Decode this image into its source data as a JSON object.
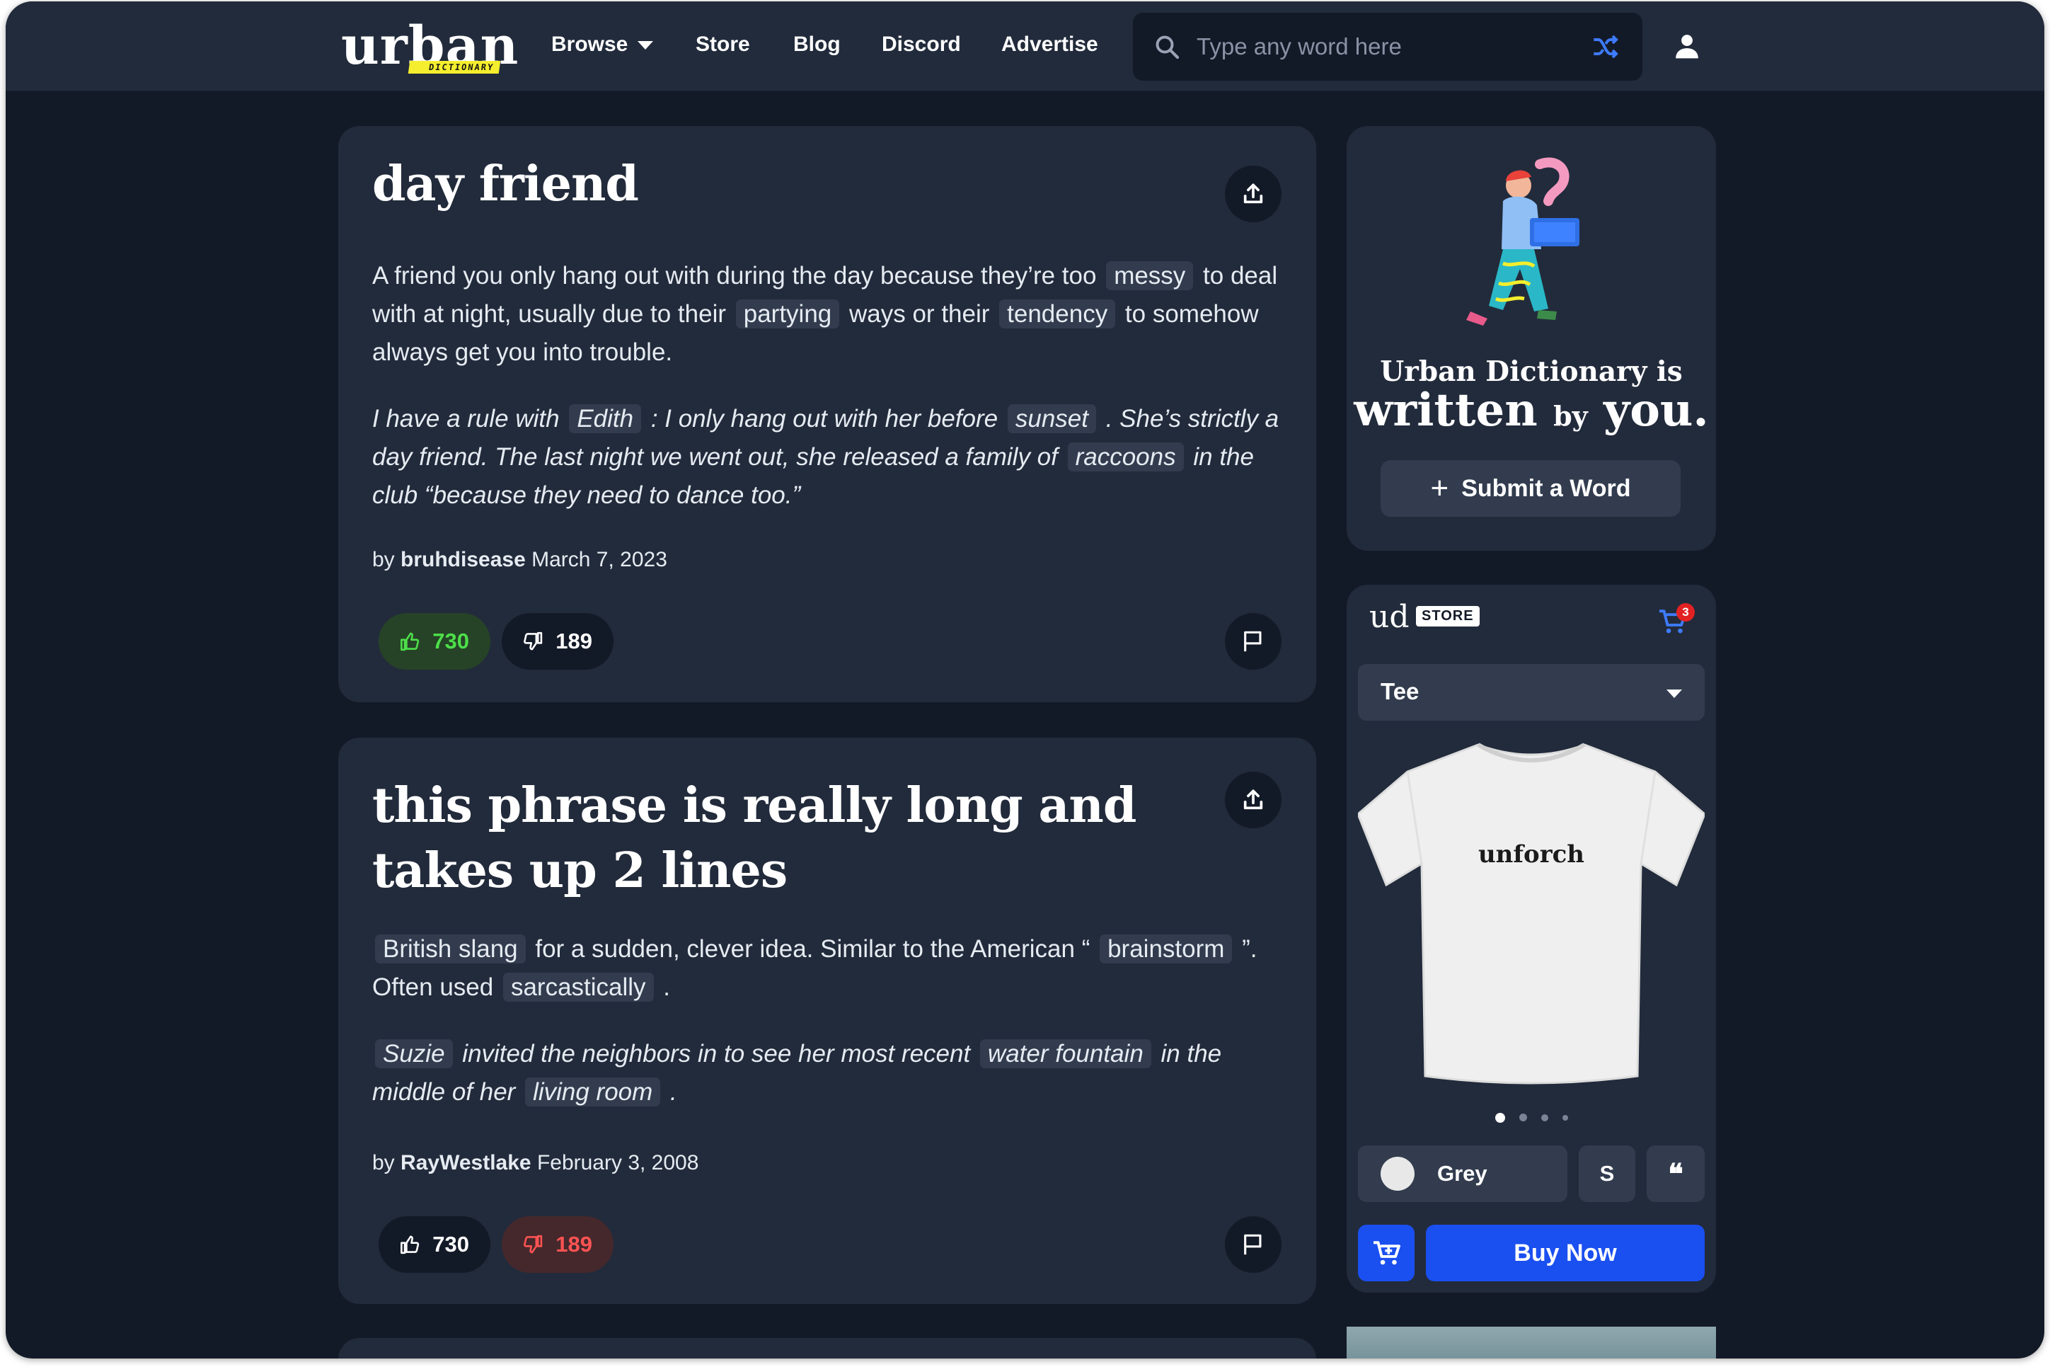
{
  "header": {
    "logo_text": "urban",
    "logo_tag": "DICTIONARY",
    "nav": [
      {
        "label": "Browse"
      },
      {
        "label": "Store"
      },
      {
        "label": "Blog"
      },
      {
        "label": "Discord"
      },
      {
        "label": "Advertise"
      }
    ],
    "search": {
      "placeholder": "Type any word here",
      "value": ""
    }
  },
  "entries": [
    {
      "word": "day friend",
      "meaning": [
        {
          "t": "A friend you only hang out with during the day because they’re too "
        },
        {
          "t": "messy",
          "link": true
        },
        {
          "t": " to deal with at night, usually due to their "
        },
        {
          "t": "partying",
          "link": true
        },
        {
          "t": " ways or their "
        },
        {
          "t": "tendency",
          "link": true
        },
        {
          "t": " to somehow always get you into trouble."
        }
      ],
      "example": [
        {
          "t": "I have a rule with "
        },
        {
          "t": "Edith",
          "link": true
        },
        {
          "t": " : I only hang out with her before "
        },
        {
          "t": "sunset",
          "link": true
        },
        {
          "t": " . She’s strictly a day friend. The last night we went out, she released a family of "
        },
        {
          "t": "raccoons",
          "link": true
        },
        {
          "t": " in the club “because they need to dance too.”"
        }
      ],
      "by": "by",
      "author": "bruhdisease",
      "date": "March 7, 2023",
      "upvotes": "730",
      "downvotes": "189"
    },
    {
      "word": "this phrase is really long and takes up 2 lines",
      "meaning": [
        {
          "t": "British slang",
          "link": true
        },
        {
          "t": " for a sudden, clever idea. Similar to the American “ "
        },
        {
          "t": "brainstorm",
          "link": true
        },
        {
          "t": " ”. Often used "
        },
        {
          "t": "sarcastically",
          "link": true
        },
        {
          "t": " ."
        }
      ],
      "example": [
        {
          "t": "Suzie",
          "link": true
        },
        {
          "t": " invited the neighbors in to see her most recent "
        },
        {
          "t": "water fountain",
          "link": true
        },
        {
          "t": " in the middle of her "
        },
        {
          "t": "living room",
          "link": true
        },
        {
          "t": " ."
        }
      ],
      "by": "by",
      "author": "RayWestlake",
      "date": "February 3, 2008",
      "upvotes": "730",
      "downvotes": "189"
    }
  ],
  "sidebar": {
    "promo": {
      "line1": "Urban Dictionary is",
      "line2_a": "written",
      "line2_by": "by",
      "line2_b": "you.",
      "submit_label": "Submit a Word"
    },
    "store": {
      "brand": "ud",
      "tag": "STORE",
      "cart_count": "3",
      "product_type": "Tee",
      "shirt_text": "unforch",
      "color": "Grey",
      "size": "S",
      "quote_icon": "❝",
      "buy_label": "Buy Now"
    }
  },
  "colors": {
    "page_bg": "#131a27",
    "card_bg": "#222b3b",
    "chip_bg": "#323c4e",
    "upvote_active": "#4ddf4a",
    "downvote_active": "#ff5353",
    "buy_blue": "#1a4ff0"
  }
}
